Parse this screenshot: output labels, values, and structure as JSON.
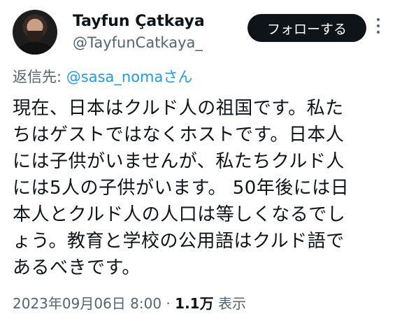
{
  "author": {
    "display_name": "Tayfun Çatkaya",
    "handle": "@TayfunCatkaya_"
  },
  "follow_button": "フォローする",
  "reply": {
    "prefix": "返信先: ",
    "mention": "@sasa_nomaさん"
  },
  "tweet_text": "現在、日本はクルド人の祖国です。私た\nちはゲストではなくホストです。日本人\nには子供がいませんが、私たちクルド人\nには5人の子供がいます。 50年後には日\n本人とクルド人の人口は等しくなるでし\nょう。教育と学校の公用語はクルド語で\nあるべきです。",
  "meta": {
    "timestamp": "2023年09月06日 8:00",
    "separator": " · ",
    "views_count": "1.1万",
    "views_label": " 表示"
  }
}
